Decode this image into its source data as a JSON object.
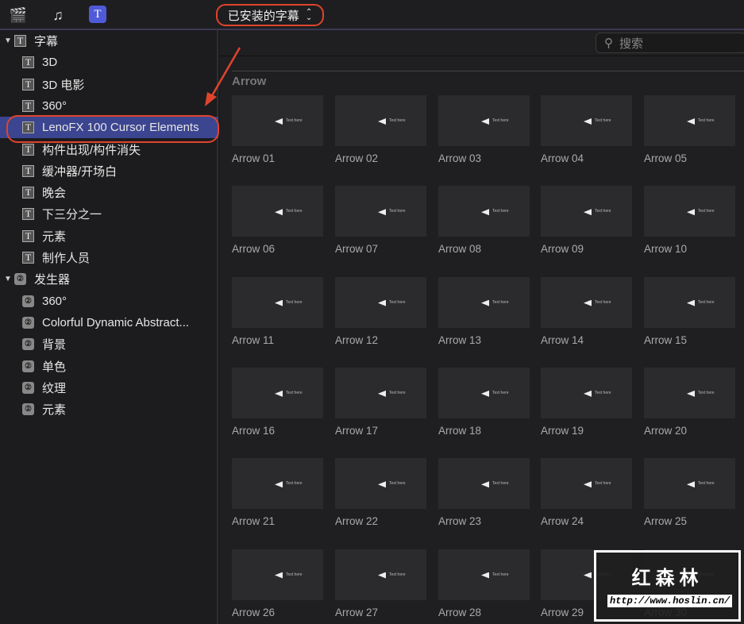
{
  "topbar": {
    "library_select": "已安装的字幕",
    "chevron": "⌃⌄"
  },
  "sidebar": {
    "groups": [
      {
        "label": "字幕",
        "type": "title",
        "items": [
          "3D",
          "3D 电影",
          "360°",
          "LenoFX 100 Cursor Elements",
          "构件出现/构件消失",
          "缓冲器/开场白",
          "晚会",
          "下三分之一",
          "元素",
          "制作人员"
        ]
      },
      {
        "label": "发生器",
        "type": "generator",
        "items": [
          "360°",
          "Colorful Dynamic Abstract...",
          "背景",
          "单色",
          "纹理",
          "元素"
        ]
      }
    ],
    "selected": "LenoFX 100 Cursor Elements"
  },
  "search": {
    "placeholder": "搜索"
  },
  "browser": {
    "section": "Arrow",
    "thumb_text": "Text here",
    "items": [
      "Arrow 01",
      "Arrow 02",
      "Arrow 03",
      "Arrow 04",
      "Arrow 05",
      "Arrow 06",
      "Arrow 07",
      "Arrow 08",
      "Arrow 09",
      "Arrow 10",
      "Arrow 11",
      "Arrow 12",
      "Arrow 13",
      "Arrow 14",
      "Arrow 15",
      "Arrow 16",
      "Arrow 17",
      "Arrow 18",
      "Arrow 19",
      "Arrow 20",
      "Arrow 21",
      "Arrow 22",
      "Arrow 23",
      "Arrow 24",
      "Arrow 25",
      "Arrow 26",
      "Arrow 27",
      "Arrow 28",
      "Arrow 29",
      "Arrow 30"
    ]
  },
  "watermark": {
    "name": "红森林",
    "url": "http://www.hoslin.cn/"
  },
  "colors": {
    "highlight": "#e0442c",
    "selection": "#3c4590"
  }
}
